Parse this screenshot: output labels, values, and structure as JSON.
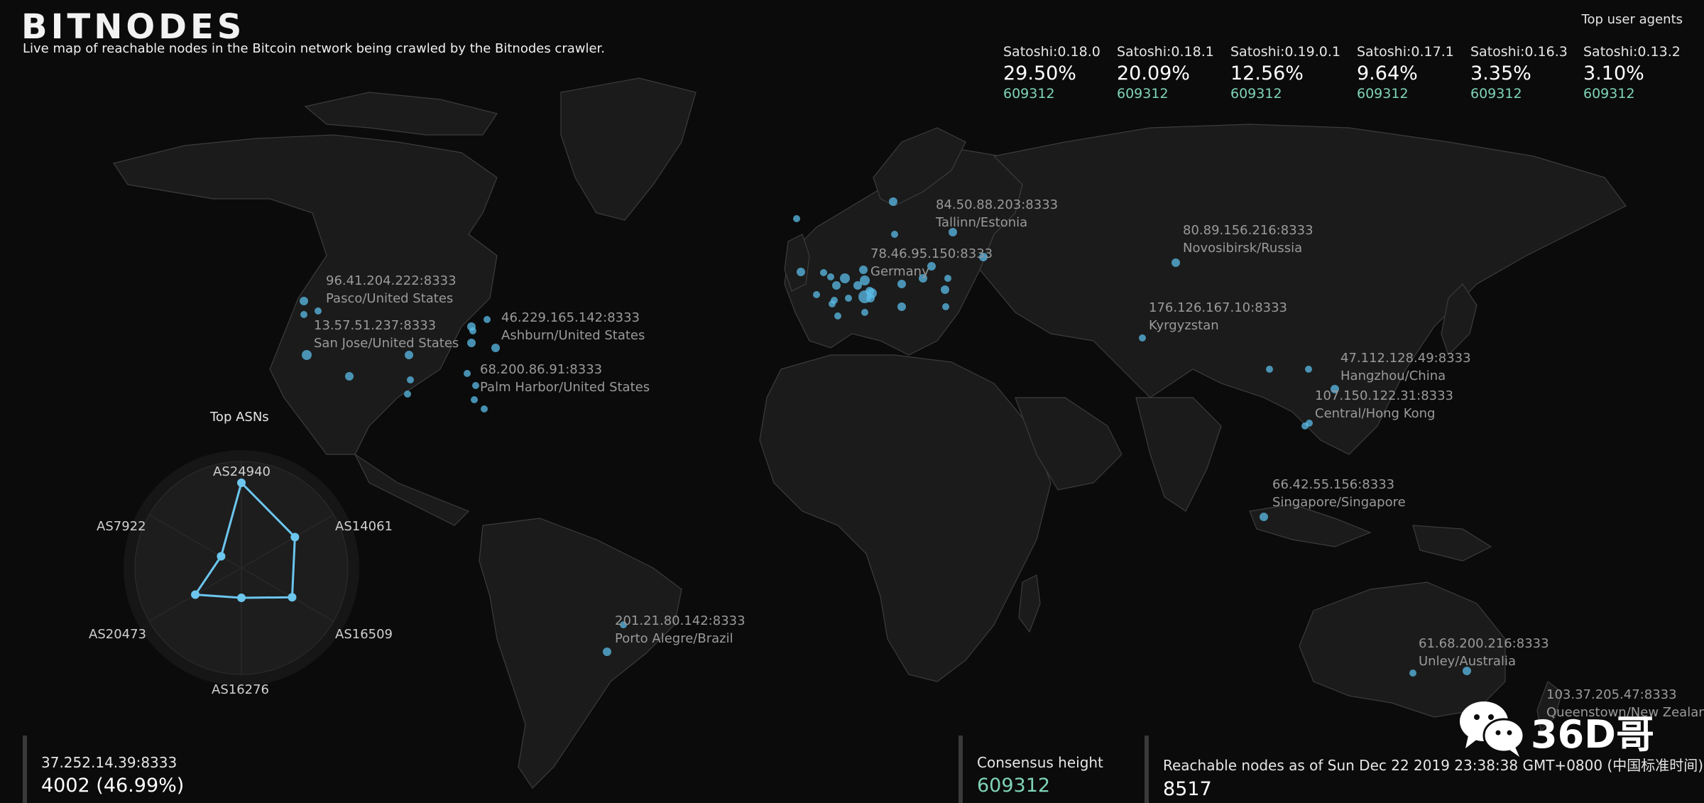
{
  "header": {
    "logo": "BITNODES",
    "tagline": "Live map of reachable nodes in the Bitcoin network being crawled by the Bitnodes crawler."
  },
  "user_agents": {
    "title": "Top user agents",
    "items": [
      {
        "name": "Satoshi:0.18.0",
        "percent": "29.50%",
        "height": "609312"
      },
      {
        "name": "Satoshi:0.18.1",
        "percent": "20.09%",
        "height": "609312"
      },
      {
        "name": "Satoshi:0.19.0.1",
        "percent": "12.56%",
        "height": "609312"
      },
      {
        "name": "Satoshi:0.17.1",
        "percent": "9.64%",
        "height": "609312"
      },
      {
        "name": "Satoshi:0.16.3",
        "percent": "3.35%",
        "height": "609312"
      },
      {
        "name": "Satoshi:0.13.2",
        "percent": "3.10%",
        "height": "609312"
      }
    ]
  },
  "map": {
    "node_labels": [
      {
        "address": "84.50.88.203:8333",
        "location": "Tallinn/Estonia"
      },
      {
        "address": "80.89.156.216:8333",
        "location": "Novosibirsk/Russia"
      },
      {
        "address": "78.46.95.150:8333",
        "location": "Germany"
      },
      {
        "address": "96.41.204.222:8333",
        "location": "Pasco/United States"
      },
      {
        "address": "13.57.51.237:8333",
        "location": "San Jose/United States"
      },
      {
        "address": "46.229.165.142:8333",
        "location": "Ashburn/United States"
      },
      {
        "address": "68.200.86.91:8333",
        "location": "Palm Harbor/United States"
      },
      {
        "address": "176.126.167.10:8333",
        "location": "Kyrgyzstan"
      },
      {
        "address": "47.112.128.49:8333",
        "location": "Hangzhou/China"
      },
      {
        "address": "107.150.122.31:8333",
        "location": "Central/Hong Kong"
      },
      {
        "address": "66.42.55.156:8333",
        "location": "Singapore/Singapore"
      },
      {
        "address": "201.21.80.142:8333",
        "location": "Porto Alegre/Brazil"
      },
      {
        "address": "61.68.200.216:8333",
        "location": "Unley/Australia"
      },
      {
        "address": "103.37.205.47:8333",
        "location": "Queenstown/New Zealand"
      }
    ],
    "node_color": "#5bbce8",
    "land_color": "#1b1b1b",
    "border_color": "#3c3c3c"
  },
  "asns": {
    "title": "Top ASNs",
    "axes": [
      "AS24940",
      "AS14061",
      "AS16509",
      "AS16276",
      "AS20473",
      "AS7922"
    ],
    "values": [
      0.8,
      0.58,
      0.55,
      0.28,
      0.5,
      0.22
    ],
    "line_color": "#6cc6ee"
  },
  "footer": {
    "top_asn": {
      "label": "37.252.14.39:8333",
      "value": "4002 (46.99%)"
    },
    "consensus": {
      "label": "Consensus height",
      "value": "609312"
    },
    "reachable": {
      "label": "Reachable nodes as of Sun Dec 22 2019 23:38:38 GMT+0800 (中国标准时间)",
      "value": "8517"
    }
  },
  "watermark": {
    "text": "36D哥"
  }
}
